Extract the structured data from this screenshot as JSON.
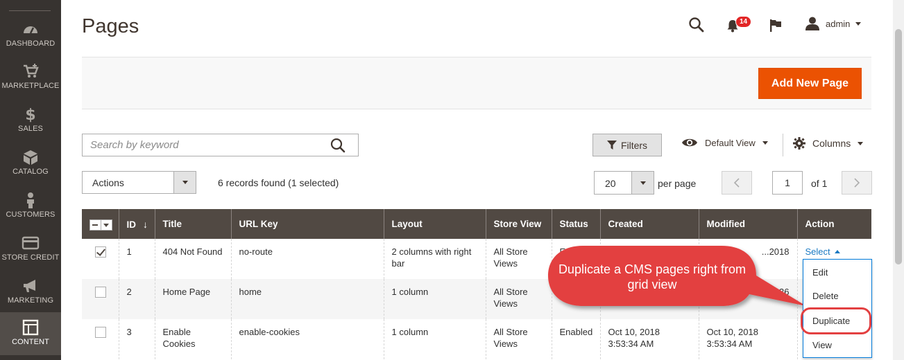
{
  "sidebar": {
    "items": [
      {
        "label": "DASHBOARD",
        "icon": "dashboard-icon"
      },
      {
        "label": "MARKETPLACE",
        "icon": "marketplace-icon"
      },
      {
        "label": "SALES",
        "icon": "dollar-icon"
      },
      {
        "label": "CATALOG",
        "icon": "box-icon"
      },
      {
        "label": "CUSTOMERS",
        "icon": "person-icon"
      },
      {
        "label": "STORE CREDIT",
        "icon": "credit-card-icon"
      },
      {
        "label": "MARKETING",
        "icon": "megaphone-icon"
      },
      {
        "label": "CONTENT",
        "icon": "layout-icon",
        "active": true
      }
    ]
  },
  "header": {
    "title": "Pages",
    "notification_count": "14",
    "user_name": "admin"
  },
  "page_actions": {
    "add_new_label": "Add New Page"
  },
  "toolbar": {
    "search_placeholder": "Search by keyword",
    "filters_label": "Filters",
    "view_label": "Default View",
    "columns_label": "Columns",
    "actions_label": "Actions",
    "records_found": "6 records found (1 selected)",
    "per_page_value": "20",
    "per_page_label": "per page",
    "current_page": "1",
    "page_of": "of 1"
  },
  "grid": {
    "columns": [
      "ID",
      "Title",
      "URL Key",
      "Layout",
      "Store View",
      "Status",
      "Created",
      "Modified",
      "Action"
    ],
    "rows": [
      {
        "checked": true,
        "id": "1",
        "title": "404 Not Found",
        "url_key": "no-route",
        "layout": "2 columns with right bar",
        "store_view": "All Store Views",
        "status": "E",
        "created": "",
        "modified": "...2018",
        "action": "Select"
      },
      {
        "checked": false,
        "id": "2",
        "title": "Home Page",
        "url_key": "home",
        "layout": "1 column",
        "store_view": "All Store Views",
        "status": "",
        "created": "",
        "modified": "...36",
        "action": ""
      },
      {
        "checked": false,
        "id": "3",
        "title": "Enable Cookies",
        "url_key": "enable-cookies",
        "layout": "1 column",
        "store_view": "All Store Views",
        "status": "Enabled",
        "created": "Oct 10, 2018 3:53:34 AM",
        "modified": "Oct 10, 2018 3:53:34 AM",
        "action": ""
      }
    ]
  },
  "action_menu": {
    "items": [
      "Edit",
      "Delete",
      "Duplicate",
      "View"
    ]
  },
  "callout": {
    "text": "Duplicate a CMS pages right from grid view",
    "color": "#e34041"
  },
  "colors": {
    "sidebar_bg": "#373330",
    "accent_orange": "#eb5202",
    "grid_header_bg": "#514943",
    "link_blue": "#1979c3"
  }
}
